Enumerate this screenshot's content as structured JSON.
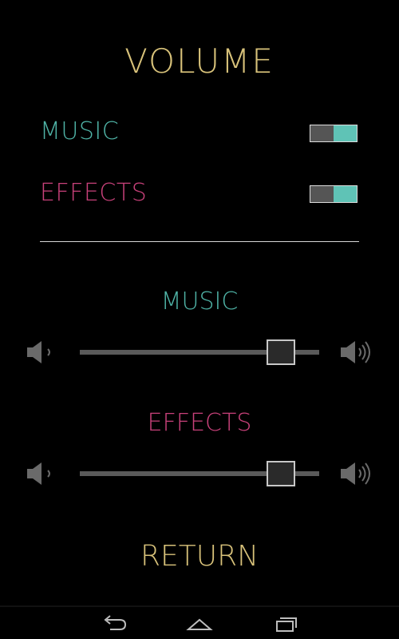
{
  "screen": {
    "title": "VOLUME",
    "return_label": "RETURN"
  },
  "toggles": {
    "music_label": "MUSIC",
    "effects_label": "EFFECTS",
    "music_on": true,
    "effects_on": true
  },
  "sliders": {
    "music_title": "MUSIC",
    "effects_title": "EFFECTS",
    "music_level": 0.84,
    "effects_level": 0.84
  },
  "colors": {
    "gold": "#d8c27a",
    "teal": "#4fb3a6",
    "pink": "#c8417a",
    "toggle_on": "#5fc3b6",
    "speaker": "#6a6a6a",
    "nav_icon": "#bdbdbd"
  },
  "icons": {
    "speaker_low": "speaker-low-icon",
    "speaker_high": "speaker-high-icon",
    "nav_back": "back-icon",
    "nav_home": "home-icon",
    "nav_recents": "recents-icon"
  }
}
